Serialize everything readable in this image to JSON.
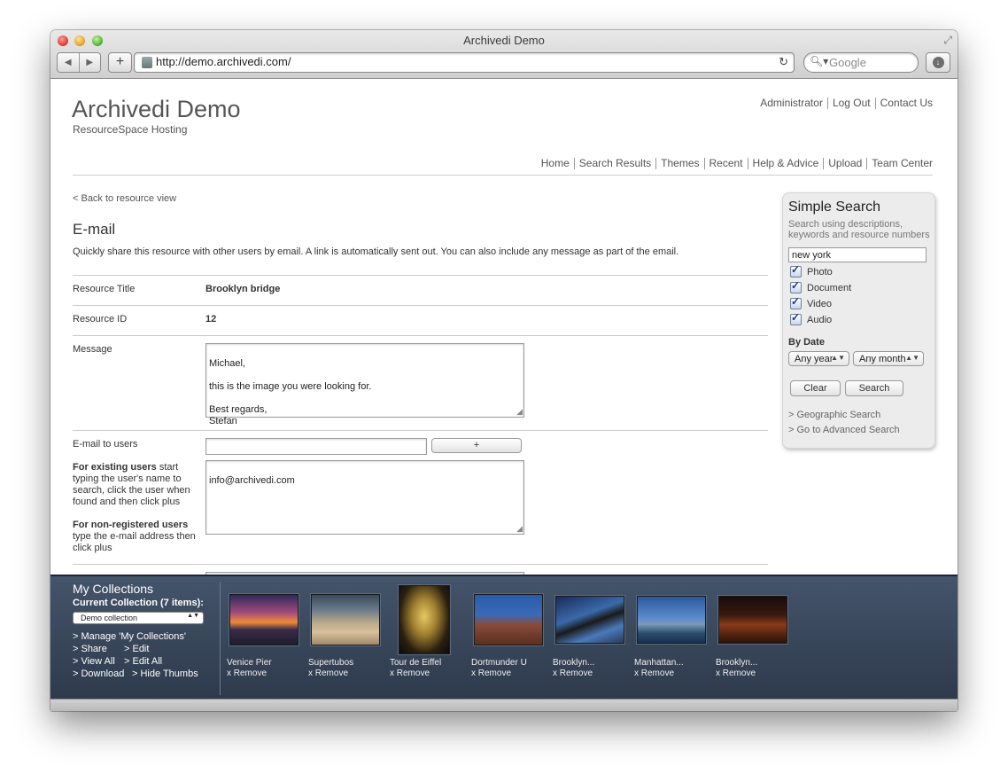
{
  "browser": {
    "title": "Archivedi Demo",
    "url": "http://demo.archivedi.com/",
    "search_placeholder": "Google"
  },
  "site": {
    "logo": "Archivedi Demo",
    "logo_sub": "ResourceSpace Hosting",
    "top_links": [
      "Administrator",
      "Log Out",
      "Contact Us"
    ],
    "nav_links": [
      "Home",
      "Search Results",
      "Themes",
      "Recent",
      "Help & Advice",
      "Upload",
      "Team Center"
    ]
  },
  "email_page": {
    "back_link": "< Back to resource view",
    "title": "E-mail",
    "intro": "Quickly share this resource with other users by email. A link is automatically sent out. You can also include any message as part of the email.",
    "resource_title_label": "Resource Title",
    "resource_title_value": "Brooklyn bridge",
    "resource_id_label": "Resource ID",
    "resource_id_value": "12",
    "message_label": "Message",
    "message_value": "Michael,\n\nthis is the image you were looking for.\n\nBest regards,\nStefan",
    "email_users_label": "E-mail to users",
    "plus_label": "+",
    "recipients_value": "info@archivedi.com",
    "help_existing_bold": "For existing users",
    "help_existing_text": " start typing the user's name to search, click the user when found and then click plus",
    "help_nonreg_bold": "For non-registered users",
    "help_nonreg_text": " type the e-mail address then click plus"
  },
  "simple_search": {
    "title": "Simple Search",
    "description": "Search using descriptions, keywords and resource numbers",
    "query": "new york",
    "types": [
      {
        "label": "Photo",
        "checked": true
      },
      {
        "label": "Document",
        "checked": true
      },
      {
        "label": "Video",
        "checked": true
      },
      {
        "label": "Audio",
        "checked": true
      }
    ],
    "by_date_label": "By Date",
    "year_select": "Any year",
    "month_select": "Any month",
    "clear_label": "Clear",
    "search_label": "Search",
    "geo_link": "> Geographic Search",
    "advanced_link": "> Go to Advanced Search"
  },
  "collections": {
    "title": "My Collections",
    "current": "Current Collection (7 items):",
    "selected": "Demo collection",
    "link_manage": "> Manage 'My Collections'",
    "link_share": "> Share",
    "link_edit": "> Edit",
    "link_viewall": "> View All",
    "link_editall": "> Edit All",
    "link_download": "> Download",
    "link_hidethumbs": "> Hide Thumbs",
    "remove_label": "x Remove",
    "items": [
      {
        "caption": "Venice Pier"
      },
      {
        "caption": "Supertubos"
      },
      {
        "caption": "Tour de Eiffel"
      },
      {
        "caption": "Dortmunder U"
      },
      {
        "caption": "Brooklyn..."
      },
      {
        "caption": "Manhattan..."
      },
      {
        "caption": "Brooklyn..."
      }
    ]
  },
  "colors": {
    "collection_bar": "#3a475a",
    "panel_bg": "#ececec",
    "link_gray": "#555555"
  }
}
